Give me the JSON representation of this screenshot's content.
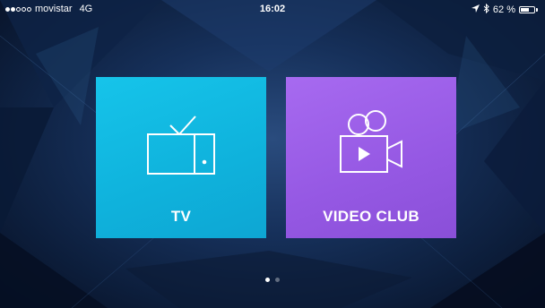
{
  "status_bar": {
    "signal_dots_filled": 2,
    "signal_dots_total": 5,
    "carrier": "movistar",
    "network": "4G",
    "time": "16:02",
    "battery_percent": "62 %",
    "battery_level": 0.62,
    "icons": [
      "location-arrow-icon",
      "bluetooth-icon",
      "battery-icon"
    ]
  },
  "tiles": [
    {
      "label": "TV",
      "icon": "tv-icon",
      "color": "#16c4ea"
    },
    {
      "label": "VIDEO CLUB",
      "icon": "movie-camera-icon",
      "color": "#9b5de5"
    }
  ],
  "pager": {
    "pages": 2,
    "current": 1
  },
  "colors": {
    "background": "#16305a",
    "tile_tv": "#16c4ea",
    "tile_videoclub": "#9b5de5"
  }
}
